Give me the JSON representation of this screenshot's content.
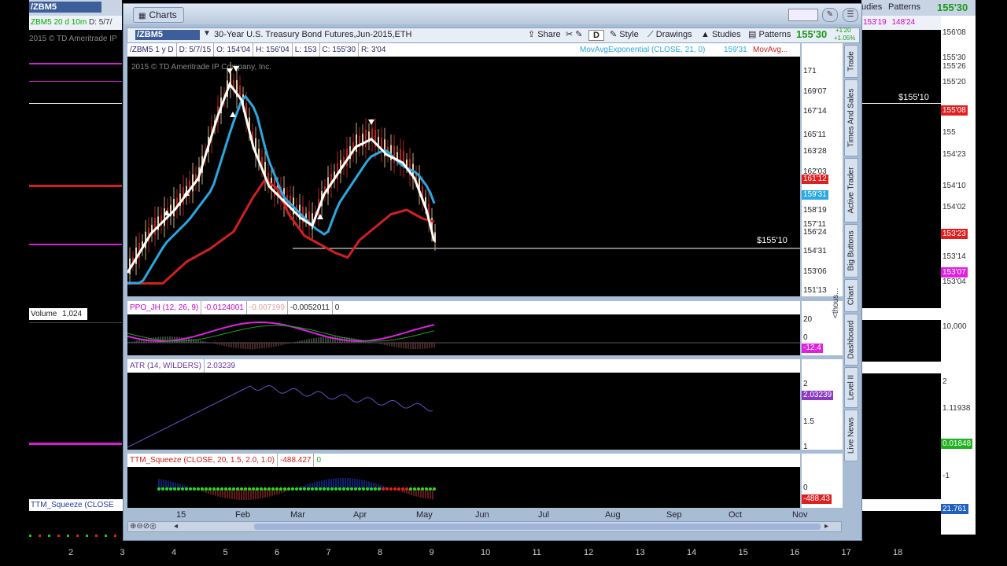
{
  "window": {
    "title": "Charts"
  },
  "toolbar": {
    "symbol": "/ZBM5",
    "description": "30-Year U.S. Treasury Bond Futures,Jun-2015,ETH",
    "share": "Share",
    "d_button": "D",
    "style": "Style",
    "drawings": "Drawings",
    "studies": "Studies",
    "patterns": "Patterns",
    "last_price": "155'30",
    "change": "+1'20",
    "change_pct": "+1.05%"
  },
  "price_header": {
    "symbol_period": "/ZBM5 1 y D",
    "date": "D: 5/7/15",
    "open": "O: 154'04",
    "high": "H: 156'04",
    "low": "L: 153",
    "close": "C: 155'30",
    "range": "R: 3'04",
    "ema_label": "MovAvgExponential (CLOSE, 21, 0)",
    "ema_value": "159'31",
    "ma_label": "MovAvg...",
    "copyright": "2015 © TD Ameritrade IP Company, Inc.",
    "price_line_label": "$155'10"
  },
  "price_axis": {
    "labels": [
      "171",
      "169'07",
      "167'14",
      "165'11",
      "163'28",
      "162'03",
      "158'19",
      "157'11",
      "156'24",
      "154'31",
      "153'06",
      "151'13"
    ],
    "badges": [
      {
        "text": "161'12",
        "color": "#e02020"
      },
      {
        "text": "159'31",
        "color": "#2aa8e0"
      }
    ]
  },
  "ppo": {
    "label": "PPO_JH (12, 26, 9)",
    "v1": "-0.0124001",
    "v2": "-0.007199",
    "v3": "-0.0052011",
    "v4": "0",
    "axis": [
      "20",
      "0"
    ],
    "badge": "-12.4",
    "unit": "<thous..."
  },
  "atr": {
    "label": "ATR (14, WILDERS)",
    "value": "2.03239",
    "axis": [
      "2",
      "1.5",
      "1"
    ],
    "badge": "2.03239"
  },
  "ttm": {
    "label": "TTM_Squeeze (CLOSE, 20, 1.5, 2.0, 1.0)",
    "value": "-488.427",
    "v2": "0",
    "axis": [
      "0"
    ],
    "badge": "-488.43"
  },
  "x_axis": [
    "15",
    "Feb",
    "Mar",
    "Apr",
    "May",
    "Jun",
    "Jul",
    "Aug",
    "Sep",
    "Oct",
    "Nov"
  ],
  "side_tabs": [
    "Trade",
    "Times And Sales",
    "Active Trader",
    "Big Buttons",
    "Chart",
    "Dashboard",
    "Level II",
    "Live News"
  ],
  "background": {
    "left_symbol": "/ZBM5",
    "left_header": "ZBM5 20 d 10m",
    "left_date": "D: 5/7/",
    "left_copyright": "2015 © TD Ameritrade IP",
    "left_volume_label": "Volume",
    "left_volume_value": "1,024",
    "left_ttm": "TTM_Squeeze (CLOSE",
    "right_tabs": [
      "udies",
      "Patterns"
    ],
    "right_price": "155'30",
    "right_header_v1": "153'19",
    "right_header_v2": "148'24",
    "right_price_line": "$155'10",
    "right_axis": [
      "156'08",
      "155'30",
      "155'26",
      "155'20",
      "155",
      "154'23",
      "154'10",
      "154'02",
      "153'14",
      "153'04",
      "10,000",
      "2",
      "1.11938",
      "-1"
    ],
    "right_badges": [
      {
        "text": "155'08",
        "color": "#e02020"
      },
      {
        "text": "153'23",
        "color": "#e02020"
      },
      {
        "text": "153'07",
        "color": "#e020e0"
      },
      {
        "text": "0.01848",
        "color": "#20b020"
      },
      {
        "text": "21.761",
        "color": "#2060c0"
      }
    ],
    "bottom_axis": [
      "2",
      "3",
      "4",
      "5",
      "6",
      "7",
      "8",
      "9",
      "10",
      "11",
      "12",
      "13",
      "14",
      "15",
      "16",
      "17",
      "18"
    ]
  }
}
